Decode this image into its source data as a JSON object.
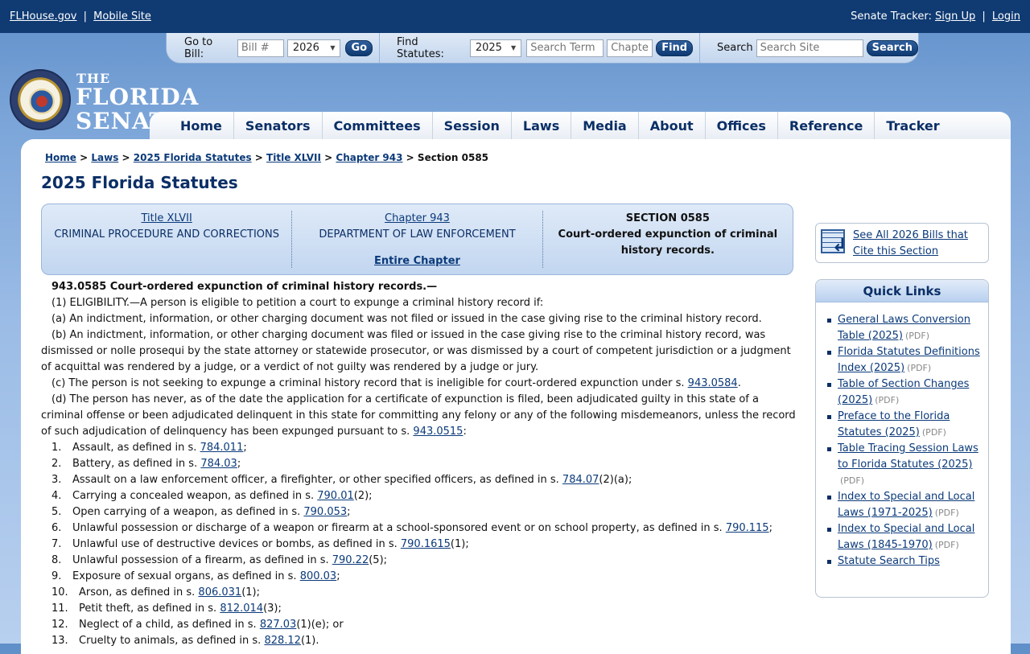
{
  "topbar": {
    "flhouse": "FLHouse.gov",
    "sep": "|",
    "mobile": "Mobile Site",
    "tracker_label": "Senate Tracker:",
    "signup": "Sign Up",
    "login": "Login"
  },
  "searchbar": {
    "goto_label": "Go to Bill:",
    "bill_placeholder": "Bill #",
    "bill_year": "2026",
    "go": "Go",
    "find_label": "Find Statutes:",
    "stat_year": "2025",
    "term_placeholder": "Search Term",
    "chapter_placeholder": "Chapter",
    "find": "Find",
    "search_label": "Search",
    "site_placeholder": "Search Site",
    "search_btn": "Search"
  },
  "logo": {
    "the": "THE",
    "florida": "FLORIDA",
    "senate": "SENATE"
  },
  "nav": [
    "Home",
    "Senators",
    "Committees",
    "Session",
    "Laws",
    "Media",
    "About",
    "Offices",
    "Reference",
    "Tracker"
  ],
  "breadcrumb": {
    "home": "Home",
    "laws": "Laws",
    "statutes": "2025 Florida Statutes",
    "title": "Title XLVII",
    "chapter": "Chapter 943",
    "current": "Section 0585",
    "sep": ">"
  },
  "page_title": "2025 Florida Statutes",
  "infobox": {
    "title_link": "Title XLVII",
    "title_name": "CRIMINAL PROCEDURE AND CORRECTIONS",
    "chapter_link": "Chapter 943",
    "chapter_name": "DEPARTMENT OF LAW ENFORCEMENT",
    "entire_chapter": "Entire Chapter",
    "section_label": "SECTION 0585",
    "section_name": "Court-ordered expunction of criminal history records."
  },
  "statute": {
    "heading": "943.0585   Court-ordered expunction of criminal history records.—",
    "p1": "(1)   ELIGIBILITY.—A person is eligible to petition a court to expunge a criminal history record if:",
    "pa": "(a)   An indictment, information, or other charging document was not filed or issued in the case giving rise to the criminal history record.",
    "pb": "(b)   An indictment, information, or other charging document was filed or issued in the case giving rise to the criminal history record, was dismissed or nolle prosequi by the state attorney or statewide prosecutor, or was dismissed by a court of competent jurisdiction or a judgment of acquittal was rendered by a judge, or a verdict of not guilty was rendered by a judge or jury.",
    "pc_text": "(c)   The person is not seeking to expunge a criminal history record that is ineligible for court-ordered expunction under s. ",
    "pc_link": "943.0584",
    "pc_end": ".",
    "pd_text": "(d)   The person has never, as of the date the application for a certificate of expunction is filed, been adjudicated guilty in this state of a criminal offense or been adjudicated delinquent in this state for committing any felony or any of the following misdemeanors, unless the record of such adjudication of delinquency has been expunged pursuant to s. ",
    "pd_link": "943.0515",
    "pd_end": ":",
    "items": [
      {
        "num": "1.",
        "text": "Assault, as defined in s. ",
        "link": "784.011",
        "after": ";"
      },
      {
        "num": "2.",
        "text": "Battery, as defined in s. ",
        "link": "784.03",
        "after": ";"
      },
      {
        "num": "3.",
        "text": "Assault on a law enforcement officer, a firefighter, or other specified officers, as defined in s. ",
        "link": "784.07",
        "after": "(2)(a);"
      },
      {
        "num": "4.",
        "text": "Carrying a concealed weapon, as defined in s. ",
        "link": "790.01",
        "after": "(2);"
      },
      {
        "num": "5.",
        "text": "Open carrying of a weapon, as defined in s. ",
        "link": "790.053",
        "after": ";"
      },
      {
        "num": "6.",
        "text": "Unlawful possession or discharge of a weapon or firearm at a school-sponsored event or on school property, as defined in s. ",
        "link": "790.115",
        "after": ";"
      },
      {
        "num": "7.",
        "text": "Unlawful use of destructive devices or bombs, as defined in s. ",
        "link": "790.1615",
        "after": "(1);"
      },
      {
        "num": "8.",
        "text": "Unlawful possession of a firearm, as defined in s. ",
        "link": "790.22",
        "after": "(5);"
      },
      {
        "num": "9.",
        "text": "Exposure of sexual organs, as defined in s. ",
        "link": "800.03",
        "after": ";"
      },
      {
        "num": "10.",
        "text": "Arson, as defined in s. ",
        "link": "806.031",
        "after": "(1);"
      },
      {
        "num": "11.",
        "text": "Petit theft, as defined in s. ",
        "link": "812.014",
        "after": "(3);"
      },
      {
        "num": "12.",
        "text": "Neglect of a child, as defined in s. ",
        "link": "827.03",
        "after": "(1)(e); or"
      },
      {
        "num": "13.",
        "text": "Cruelty to animals, as defined in s. ",
        "link": "828.12",
        "after": "(1)."
      }
    ]
  },
  "bills_box": {
    "label": "See All 2026 Bills that Cite this Section"
  },
  "quick_links": {
    "title": "Quick Links",
    "items": [
      {
        "label": "General Laws Conversion Table (2025)",
        "pdf": "(PDF)"
      },
      {
        "label": "Florida Statutes Definitions Index (2025)",
        "pdf": "(PDF)"
      },
      {
        "label": "Table of Section Changes (2025)",
        "pdf": "(PDF)"
      },
      {
        "label": "Preface to the Florida Statutes (2025)",
        "pdf": "(PDF)"
      },
      {
        "label": "Table Tracing Session Laws to Florida Statutes (2025)",
        "pdf": "(PDF)"
      },
      {
        "label": "Index to Special and Local Laws (1971-2025)",
        "pdf": "(PDF)"
      },
      {
        "label": "Index to Special and Local Laws (1845-1970)",
        "pdf": "(PDF)"
      },
      {
        "label": "Statute Search Tips",
        "pdf": ""
      }
    ]
  }
}
